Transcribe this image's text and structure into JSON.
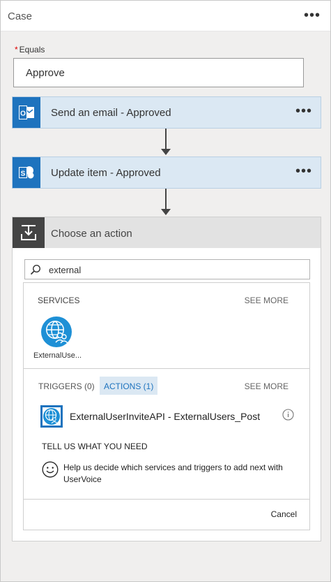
{
  "case": {
    "title": "Case",
    "more": "•••"
  },
  "equals": {
    "required_marker": "*",
    "label": "Equals",
    "value": "Approve"
  },
  "actions": [
    {
      "label": "Send an email - Approved",
      "more": "•••",
      "icon": "outlook-icon"
    },
    {
      "label": "Update item - Approved",
      "more": "•••",
      "icon": "sharepoint-icon"
    }
  ],
  "choose_action": {
    "title": "Choose an action",
    "icon": "download-tray-icon",
    "search": {
      "value": "external",
      "icon": "search-icon"
    },
    "services": {
      "header": "SERVICES",
      "see_more": "SEE MORE",
      "items": [
        {
          "name": "ExternalUse...",
          "icon": "globe-users-icon"
        }
      ]
    },
    "tabs": {
      "triggers": "TRIGGERS (0)",
      "actions": "ACTIONS (1)",
      "see_more": "SEE MORE"
    },
    "action_results": [
      {
        "label": "ExternalUserInviteAPI - ExternalUsers_Post",
        "icon": "globe-users-icon"
      }
    ],
    "tell_us": {
      "header": "TELL US WHAT YOU NEED",
      "text": "Help us decide which services and triggers to add next with UserVoice",
      "icon": "smiley-icon"
    },
    "cancel": "Cancel"
  },
  "colors": {
    "accent": "#1e73be",
    "action_bg": "#dbe8f3",
    "header_dark": "#444444"
  }
}
